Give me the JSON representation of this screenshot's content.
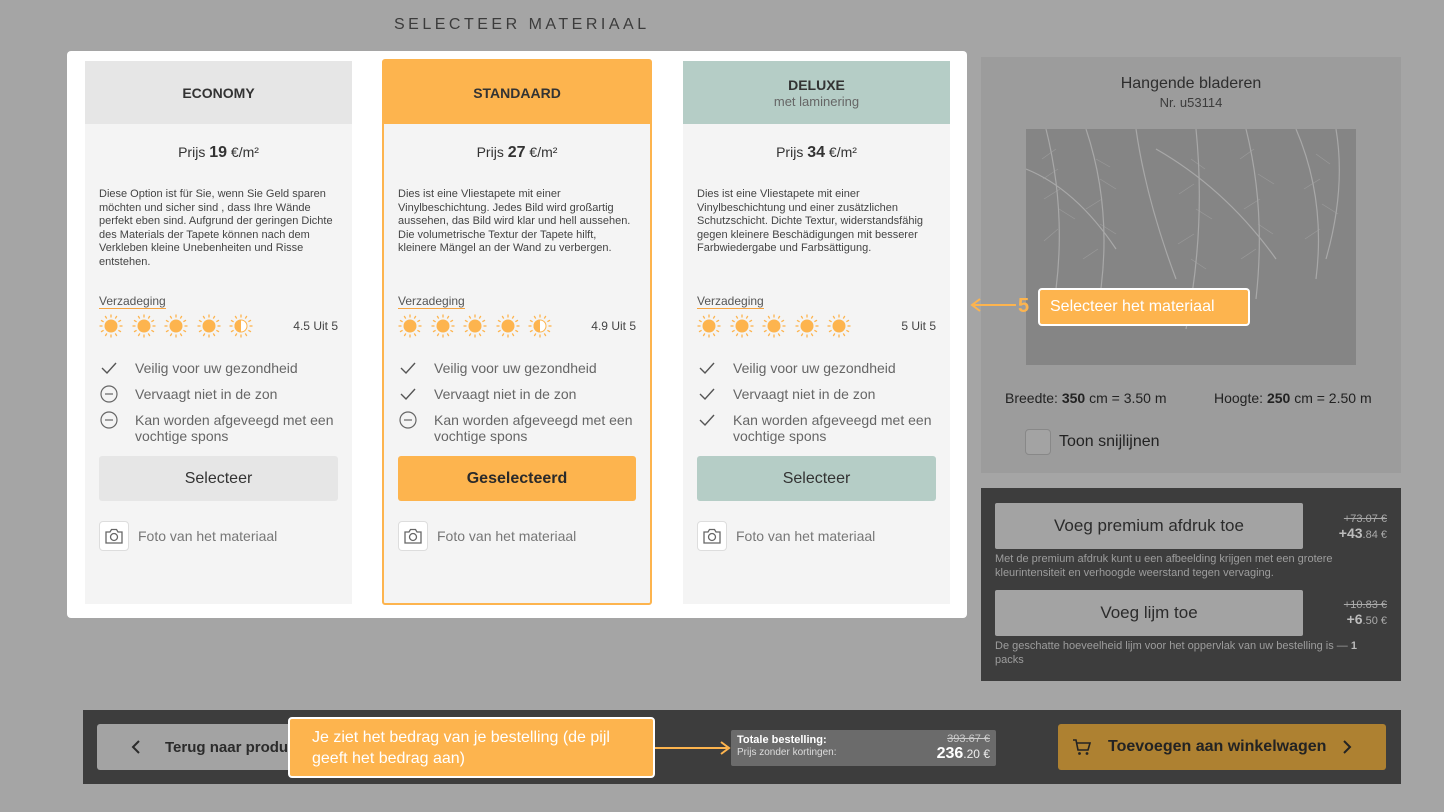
{
  "heading": "SELECTEER MATERIAAL",
  "cards": [
    {
      "name": "ECONOMY",
      "sub": "",
      "price_label": "Prijs",
      "price_value": "19",
      "price_unit": "€/m²",
      "description": "Diese Option ist für Sie, wenn Sie Geld sparen möchten und sicher sind , dass Ihre Wände perfekt eben sind. Aufgrund der geringen Dichte des Materials der Tapete können nach dem Verkleben kleine Unebenheiten und Risse entstehen.",
      "rating_label": "Verzadeging",
      "rating": 4.5,
      "rating_text": "4.5 Uit 5",
      "features": [
        {
          "icon": "check-icon",
          "text": "Veilig voor uw gezondheid"
        },
        {
          "icon": "minus-circle-icon",
          "text": "Vervaagt niet in de zon"
        },
        {
          "icon": "minus-circle-icon",
          "text": "Kan worden afgeveegd met een vochtige spons"
        }
      ],
      "button": "Selecteer",
      "photo_link": "Foto van het materiaal"
    },
    {
      "name": "STANDAARD",
      "sub": "",
      "price_label": "Prijs",
      "price_value": "27",
      "price_unit": "€/m²",
      "description": "Dies ist eine Vliestapete mit einer Vinylbeschichtung. Jedes Bild wird großartig aussehen, das Bild wird klar und hell aussehen. Die volumetrische Textur der Tapete hilft, kleinere Mängel an der Wand zu verbergen.",
      "rating_label": "Verzadeging",
      "rating": 4.5,
      "rating_text": "4.9 Uit 5",
      "features": [
        {
          "icon": "check-icon",
          "text": "Veilig voor uw gezondheid"
        },
        {
          "icon": "check-icon",
          "text": "Vervaagt niet in de zon"
        },
        {
          "icon": "minus-circle-icon",
          "text": "Kan worden afgeveegd met een vochtige spons"
        }
      ],
      "button": "Geselecteerd",
      "photo_link": "Foto van het materiaal"
    },
    {
      "name": "DELUXE",
      "sub": "met laminering",
      "price_label": "Prijs",
      "price_value": "34",
      "price_unit": "€/m²",
      "description": "Dies ist eine Vliestapete mit einer Vinylbeschichtung und einer zusätzlichen Schutzschicht. Dichte Textur, widerstandsfähig gegen kleinere Beschädigungen mit besserer Farbwiedergabe und Farbsättigung.",
      "rating_label": "Verzadeging",
      "rating": 5,
      "rating_text": "5 Uit 5",
      "features": [
        {
          "icon": "check-icon",
          "text": "Veilig voor uw gezondheid"
        },
        {
          "icon": "check-icon",
          "text": "Vervaagt niet in de zon"
        },
        {
          "icon": "check-icon",
          "text": "Kan worden afgeveegd met een vochtige spons"
        }
      ],
      "button": "Selecteer",
      "photo_link": "Foto van het materiaal"
    }
  ],
  "product": {
    "title": "Hangende bladeren",
    "number": "Nr. u53114",
    "width_label": "Breedte:",
    "width_cm": "350",
    "width_rest": "cm = 3.50 m",
    "height_label": "Hoogte:",
    "height_cm": "250",
    "height_rest": "cm = 2.50 m",
    "cutlines": "Toon snijlijnen"
  },
  "addons": {
    "premium_button": "Voeg premium afdruk toe",
    "premium_old": "+73.07 €",
    "premium_new_main": "+43",
    "premium_new_cents": ".84 €",
    "premium_note": "Met de premium afdruk kunt u een afbeelding krijgen met een grotere kleurintensiteit en verhoogde weerstand tegen vervaging.",
    "glue_button": "Voeg lijm toe",
    "glue_old": "+10.83 €",
    "glue_new_main": "+6",
    "glue_new_cents": ".50 €",
    "glue_note": "De geschatte hoeveelheid lijm voor het oppervlak van uw bestelling is —",
    "glue_qty": "1",
    "glue_unit": "packs"
  },
  "bottom": {
    "back": "Terug naar product",
    "total_label": "Totale bestelling:",
    "total_sub": "Prijs zonder kortingen:",
    "total_old": "393.67 €",
    "total_main": "236",
    "total_cents": ".20 €",
    "cart": "Toevoegen aan winkelwagen"
  },
  "tutorial": {
    "step": "5",
    "step_text": "Selecteer het materiaal",
    "price_tip": "Je ziet het bedrag van je bestelling (de pijl geeft het bedrag aan)"
  },
  "colors": {
    "accent": "#fdb44e",
    "economy_head": "#e6e6e6",
    "deluxe_head": "#b5cdc6",
    "overlay": "#a5a5a5"
  }
}
